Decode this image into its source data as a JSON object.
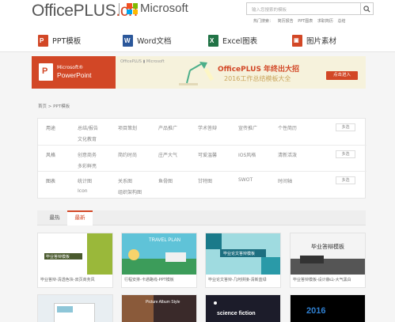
{
  "header": {
    "logo_office": "OfficePLUS",
    "logo_cn": ".cn",
    "microsoft": "Microsoft",
    "search_placeholder": "输入您搜索的模板",
    "hot_label": "热门搜索：",
    "hot_items": [
      "简历报告",
      "PPT图表",
      "求职简历",
      "总结"
    ]
  },
  "categories": [
    {
      "label": "PPT模板",
      "icon": "powerpoint-icon",
      "color": "#d24726",
      "letter": "P"
    },
    {
      "label": "Word文档",
      "icon": "word-icon",
      "color": "#2b579a",
      "letter": "W"
    },
    {
      "label": "Excel图表",
      "icon": "excel-icon",
      "color": "#217346",
      "letter": "X"
    },
    {
      "label": "图片素材",
      "icon": "picture-icon",
      "color": "#d24726",
      "letter": "▣"
    }
  ],
  "banner": {
    "product_small": "Microsoft®",
    "product": "PowerPoint",
    "brand": "OfficePLUS ▮ Microsoft",
    "title": "OfficePLUS 年终出大招",
    "subtitle": "2016工作总结模板大全",
    "cta": "点击进入"
  },
  "breadcrumb": "首页 > PPT模板",
  "filters": [
    {
      "label": "用途",
      "options": [
        "总结/报告",
        "项目策划",
        "产品推广",
        "学术答辩",
        "宣传推广",
        "个性简历",
        "文化教育"
      ],
      "more": "多选"
    },
    {
      "label": "风格",
      "options": [
        "创意商务",
        "简约时尚",
        "庄严大气",
        "可爱温馨",
        "IOS风格",
        "清新活泼",
        "多彩鲜亮"
      ],
      "more": "多选"
    },
    {
      "label": "图表",
      "options": [
        "统计图",
        "关系图",
        "鱼骨图",
        "甘特图",
        "SWOT",
        "时间轴",
        "Icon",
        "组织架构图"
      ],
      "more": "多选"
    }
  ],
  "tabs": [
    "最热",
    "最新"
  ],
  "cards": [
    {
      "caption": "毕业答辩-清透色块-双页商务风",
      "thumb_text": "毕业答辩模板"
    },
    {
      "caption": "行程安排-卡通路线-PPT模板",
      "thumb_text": "TRAVEL PLAN"
    },
    {
      "caption": "毕业论文答辩-几何拼接-清新蓝绿",
      "thumb_text": "毕业论文答辩模板"
    },
    {
      "caption": "毕业答辩模板-设计静山-大气黑白",
      "thumb_text": "毕业答辩模板"
    },
    {
      "caption": "",
      "thumb_text": ""
    },
    {
      "caption": "",
      "thumb_text": "Picture Album Style"
    },
    {
      "caption": "",
      "thumb_text": "science fiction"
    },
    {
      "caption": "",
      "thumb_text": "2016"
    }
  ],
  "colors": {
    "accent": "#d24726",
    "background": "#f5f5f5"
  }
}
